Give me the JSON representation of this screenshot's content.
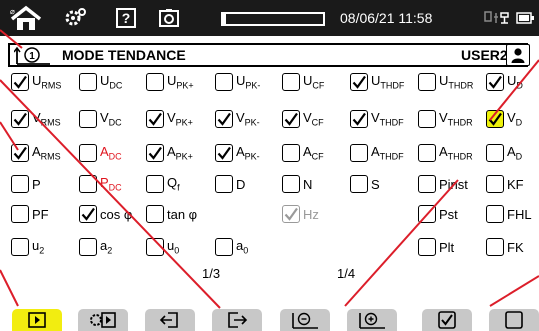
{
  "status_bar": {
    "datetime": "08/06/21 11:58",
    "recording_progress": 0.03
  },
  "header": {
    "title": "MODE TENDANCE",
    "user": "USER2"
  },
  "grid": {
    "rows": [
      [
        {
          "base": "U",
          "sub": "RMS",
          "checked": true
        },
        {
          "base": "U",
          "sub": "DC",
          "checked": false
        },
        {
          "base": "U",
          "sub": "PK+",
          "checked": false
        },
        {
          "base": "U",
          "sub": "PK-",
          "checked": false
        },
        {
          "base": "U",
          "sub": "CF",
          "checked": false
        },
        {
          "base": "U",
          "sub": "THDF",
          "checked": true
        },
        {
          "base": "U",
          "sub": "THDR",
          "checked": false
        },
        {
          "base": "U",
          "sub": "D",
          "checked": true
        }
      ],
      [
        {
          "base": "V",
          "sub": "RMS",
          "checked": true
        },
        {
          "base": "V",
          "sub": "DC",
          "checked": false
        },
        {
          "base": "V",
          "sub": "PK+",
          "checked": true
        },
        {
          "base": "V",
          "sub": "PK-",
          "checked": true
        },
        {
          "base": "V",
          "sub": "CF",
          "checked": true
        },
        {
          "base": "V",
          "sub": "THDF",
          "checked": true
        },
        {
          "base": "V",
          "sub": "THDR",
          "checked": false
        },
        {
          "base": "V",
          "sub": "D",
          "checked": true,
          "highlight": true
        }
      ],
      [
        {
          "base": "A",
          "sub": "RMS",
          "checked": true
        },
        {
          "base": "A",
          "sub": "DC",
          "checked": false,
          "red": true
        },
        {
          "base": "A",
          "sub": "PK+",
          "checked": true
        },
        {
          "base": "A",
          "sub": "PK-",
          "checked": true
        },
        {
          "base": "A",
          "sub": "CF",
          "checked": false
        },
        {
          "base": "A",
          "sub": "THDF",
          "checked": false
        },
        {
          "base": "A",
          "sub": "THDR",
          "checked": false
        },
        {
          "base": "A",
          "sub": "D",
          "checked": false
        }
      ],
      [
        {
          "base": "P",
          "sub": "",
          "checked": false
        },
        {
          "base": "P",
          "sub": "DC",
          "checked": false,
          "red": true
        },
        {
          "base": "Q",
          "sub": "f",
          "checked": false
        },
        {
          "base": "D",
          "sub": "",
          "checked": false
        },
        {
          "base": "N",
          "sub": "",
          "checked": false
        },
        {
          "base": "S",
          "sub": "",
          "checked": false
        },
        {
          "base": "Pinst",
          "sub": "",
          "checked": false
        },
        {
          "base": "KF",
          "sub": "",
          "checked": false
        }
      ],
      [
        {
          "base": "PF",
          "sub": "",
          "checked": false
        },
        {
          "base": "cos φ",
          "sub": "",
          "checked": true
        },
        {
          "base": "tan φ",
          "sub": "",
          "checked": false
        },
        null,
        {
          "base": "Hz",
          "sub": "",
          "checked": true,
          "disabled": true
        },
        null,
        {
          "base": "Pst",
          "sub": "",
          "checked": false
        },
        {
          "base": "FHL",
          "sub": "",
          "checked": false
        }
      ],
      [
        {
          "base": "u",
          "sub": "2",
          "checked": false
        },
        {
          "base": "a",
          "sub": "2",
          "checked": false
        },
        {
          "base": "u",
          "sub": "0",
          "checked": false
        },
        {
          "base": "a",
          "sub": "0",
          "checked": false
        },
        null,
        null,
        {
          "base": "Plt",
          "sub": "",
          "checked": false
        },
        {
          "base": "FK",
          "sub": "",
          "checked": false
        }
      ]
    ]
  },
  "pages": {
    "left": "1/3",
    "right": "1/4"
  },
  "function_keys": [
    {
      "icon": "play-icon",
      "active": true
    },
    {
      "icon": "play-settings-icon",
      "active": false
    },
    {
      "icon": "import-icon",
      "active": false
    },
    {
      "icon": "export-icon",
      "active": false
    },
    {
      "icon": "timer-minus-icon",
      "active": false
    },
    {
      "icon": "timer-plus-icon",
      "active": false
    },
    {
      "icon": "check-all-icon",
      "active": false
    },
    {
      "icon": "uncheck-all-icon",
      "active": false
    }
  ]
}
